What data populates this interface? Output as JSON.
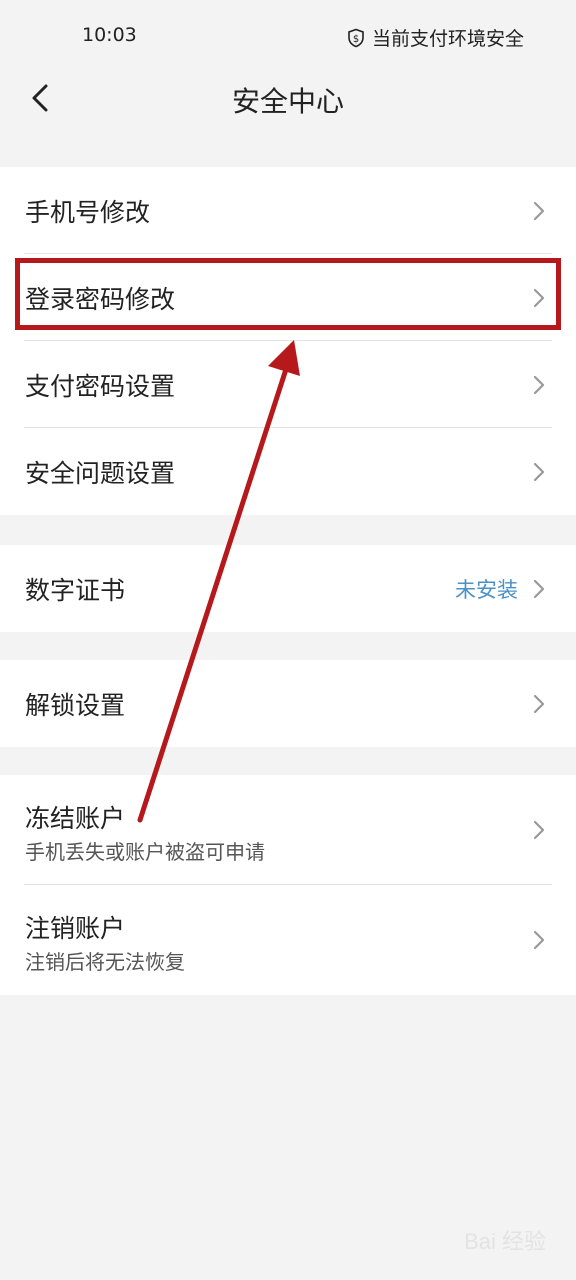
{
  "status_bar": {
    "time": "10:03",
    "security_text": "当前支付环境安全"
  },
  "header": {
    "title": "安全中心"
  },
  "group1": [
    {
      "label": "手机号修改"
    },
    {
      "label": "登录密码修改"
    },
    {
      "label": "支付密码设置"
    },
    {
      "label": "安全问题设置"
    }
  ],
  "group2": [
    {
      "label": "数字证书",
      "value": "未安装"
    }
  ],
  "group3": [
    {
      "label": "解锁设置"
    }
  ],
  "group4": [
    {
      "label": "冻结账户",
      "sub": "手机丢失或账户被盗可申请"
    },
    {
      "label": "注销账户",
      "sub": "注销后将无法恢复"
    }
  ],
  "watermark": {
    "text": "Bai 经验"
  },
  "colors": {
    "annotation": "#b5191b",
    "value_blue": "#4a90c9"
  }
}
